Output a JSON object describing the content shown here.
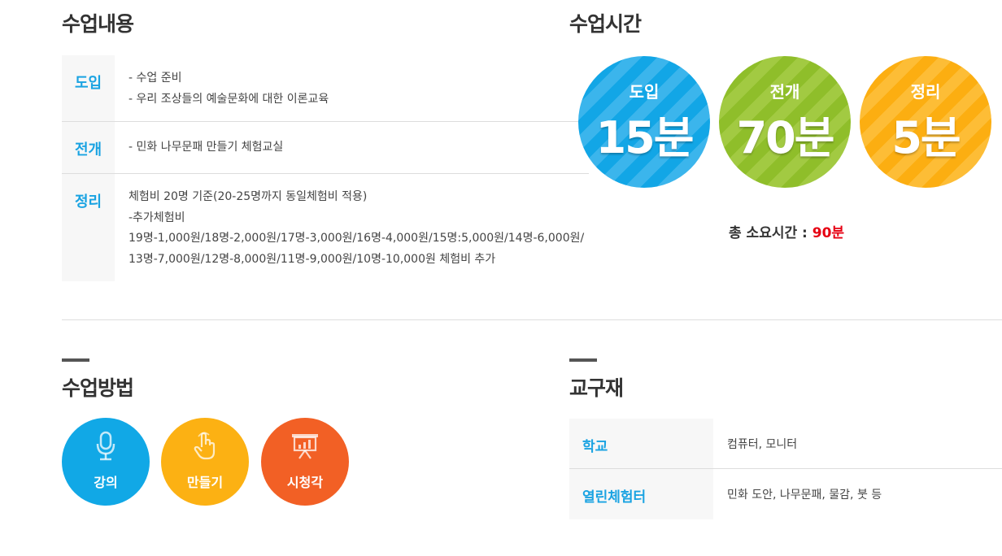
{
  "lesson_content": {
    "title": "수업내용",
    "rows": [
      {
        "head": "도입",
        "lines": [
          "- 수업 준비",
          "- 우리 조상들의 예술문화에 대한 이론교육"
        ]
      },
      {
        "head": "전개",
        "lines": [
          "- 민화 나무문패 만들기 체험교실"
        ]
      },
      {
        "head": "정리",
        "lines": [
          "체험비 20명 기준(20-25명까지 동일체험비 적용)",
          "-추가체험비",
          "19명-1,000원/18명-2,000원/17명-3,000원/16명-4,000원/15명:5,000원/14명-6,000원/",
          "13명-7,000원/12명-8,000원/11명-9,000원/10명-10,000원 체험비 추가"
        ]
      }
    ]
  },
  "lesson_time": {
    "title": "수업시간",
    "circles": [
      {
        "label": "도입",
        "value": "15분",
        "color": "#12a6e6"
      },
      {
        "label": "전개",
        "value": "70분",
        "color": "#8fbe2a"
      },
      {
        "label": "정리",
        "value": "5분",
        "color": "#fcae11"
      }
    ],
    "total_label": "총 소요시간 : ",
    "total_value": "90분",
    "total_color": "#e60012"
  },
  "lesson_method": {
    "title": "수업방법",
    "items": [
      {
        "label": "강의",
        "icon": "microphone-icon",
        "color": "#11a8e6"
      },
      {
        "label": "만들기",
        "icon": "hand-pointer-icon",
        "color": "#fcb113"
      },
      {
        "label": "시청각",
        "icon": "presentation-board-icon",
        "color": "#f26025"
      }
    ]
  },
  "materials": {
    "title": "교구재",
    "rows": [
      {
        "head": "학교",
        "value": "컴퓨터, 모니터"
      },
      {
        "head": "열린체험터",
        "value": "민화 도안, 나무문패, 물감, 붓 등"
      }
    ]
  }
}
